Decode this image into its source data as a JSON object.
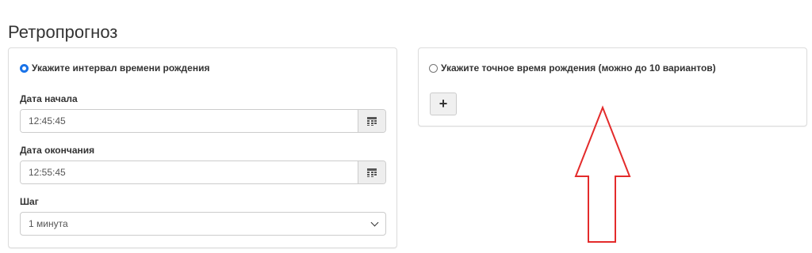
{
  "page": {
    "title": "Ретропрогноз"
  },
  "interval_panel": {
    "radio_label": "Укажите интервал времени рождения",
    "radio_checked": true,
    "start": {
      "label": "Дата начала",
      "value": "12:45:45",
      "icon": "calendar-icon"
    },
    "end": {
      "label": "Дата окончания",
      "value": "12:55:45",
      "icon": "calendar-icon"
    },
    "step": {
      "label": "Шаг",
      "selected": "1 минута",
      "icon": "chevron-down-icon"
    }
  },
  "exact_panel": {
    "radio_label": "Укажите точное время рождения (можно до 10 вариантов)",
    "radio_checked": false,
    "add_button_label": "+"
  },
  "annotation": {
    "icon": "red-outline-arrow-up",
    "color": "#e32b2b"
  },
  "colors": {
    "radio_accent": "#1a73e8",
    "addon_bg": "#eeeeee",
    "border": "#cccccc"
  }
}
